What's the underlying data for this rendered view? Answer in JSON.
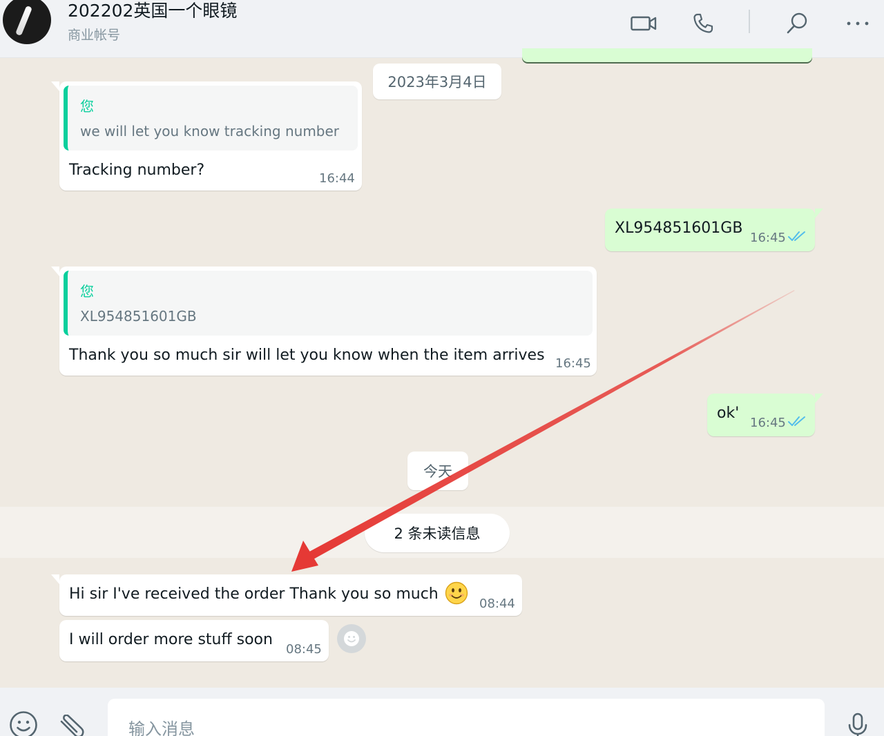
{
  "header": {
    "contact_name": "202202英国一个眼镜",
    "contact_subtitle": "商业帐号",
    "icons": [
      "video-call-icon",
      "voice-call-icon",
      "search-icon",
      "more-options-icon"
    ]
  },
  "date_chips": {
    "old_date": "2023年3月4日",
    "today": "今天"
  },
  "unread_banner": "2 条未读信息",
  "messages": [
    {
      "direction": "incoming",
      "quote_author": "您",
      "quote_text": "we will let you know tracking number",
      "text": "Tracking number?",
      "time": "16:44"
    },
    {
      "direction": "outgoing",
      "text": "XL954851601GB",
      "time": "16:45",
      "status": "read"
    },
    {
      "direction": "incoming",
      "quote_author": "您",
      "quote_text": "XL954851601GB",
      "text": "Thank you so much sir will let you know when the item arrives",
      "time": "16:45"
    },
    {
      "direction": "outgoing",
      "text": "ok'",
      "time": "16:45",
      "status": "read"
    },
    {
      "direction": "incoming",
      "text": "Hi sir I've received the order Thank you so much",
      "emoji": "smiling-face-emoji",
      "time": "08:44"
    },
    {
      "direction": "incoming",
      "text": "I will order more stuff soon",
      "time": "08:45"
    }
  ],
  "composer": {
    "placeholder": "输入消息",
    "icons": [
      "emoji-icon",
      "attach-icon",
      "microphone-icon"
    ]
  },
  "colors": {
    "chat_background": "#efeae2",
    "incoming_bubble": "#ffffff",
    "outgoing_bubble": "#d9fdd3",
    "quote_accent": "#06cf9c",
    "read_ticks": "#53bdeb",
    "annotation_arrow": "#e53935"
  }
}
